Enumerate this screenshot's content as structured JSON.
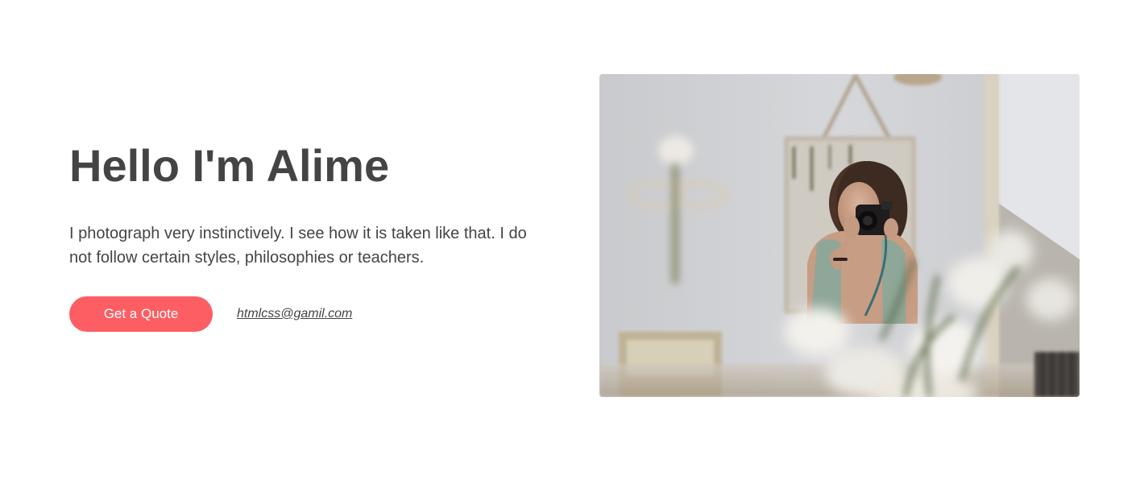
{
  "hero": {
    "title": "Hello I'm Alime",
    "description": "I photograph very instinctively. I see how it is taken like that. I do not follow certain styles, philosophies or teachers.",
    "quote_button_label": "Get a Quote",
    "email_link": "htmlcss@gamil.com"
  },
  "colors": {
    "accent": "#fc5e63",
    "text": "#444444",
    "background": "#ffffff"
  },
  "photo": {
    "subject": "woman-with-camera-photo"
  }
}
